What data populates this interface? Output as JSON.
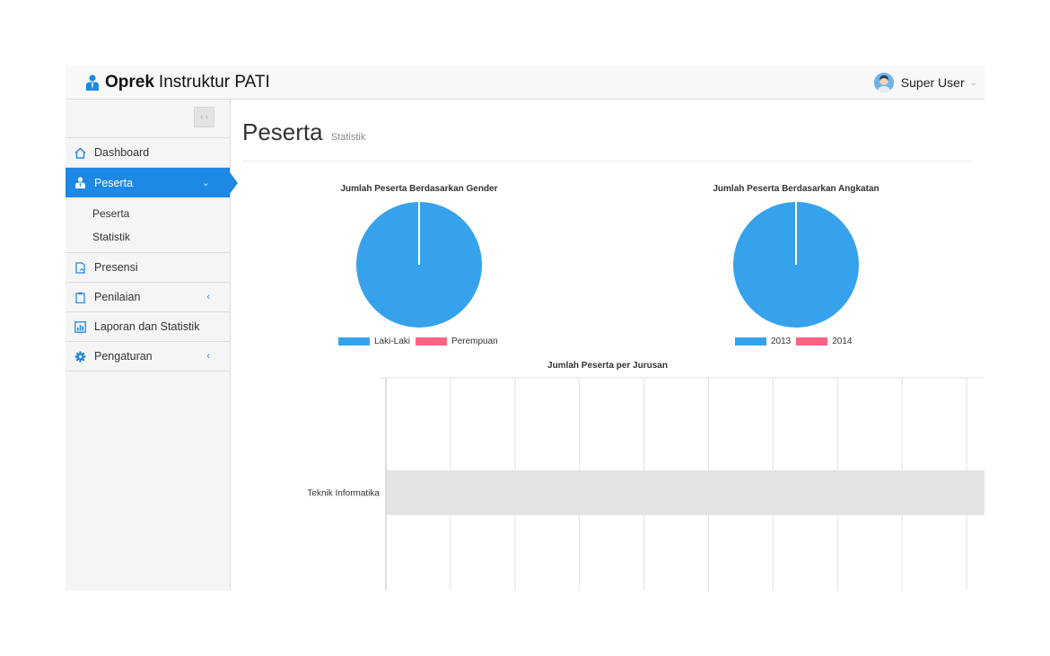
{
  "app": {
    "brand_bold": "Oprek",
    "brand_rest": "Instruktur PATI"
  },
  "user": {
    "name": "Super User"
  },
  "sidebar": {
    "toggle_glyph": "‹ ›",
    "items": [
      {
        "label": "Dashboard",
        "icon": "home-icon"
      },
      {
        "label": "Peserta",
        "icon": "user-icon",
        "active": true,
        "caret": "⌄"
      },
      {
        "label": "Presensi",
        "icon": "document-icon"
      },
      {
        "label": "Penilaian",
        "icon": "clipboard-icon",
        "caret": "‹"
      },
      {
        "label": "Laporan dan Statistik",
        "icon": "bar-chart-icon"
      },
      {
        "label": "Pengaturan",
        "icon": "gear-icon",
        "caret": "‹"
      }
    ],
    "submenu": [
      "Peserta",
      "Statistik"
    ]
  },
  "page": {
    "title": "Peserta",
    "subtitle": "Statistik"
  },
  "colors": {
    "accent": "#1e88e5",
    "series_blue": "#36a2eb",
    "series_pink": "#ff6384"
  },
  "chart_data": [
    {
      "type": "pie",
      "title": "Jumlah Peserta Berdasarkan Gender",
      "labels": [
        "Laki-Laki",
        "Perempuan"
      ],
      "values": [
        1,
        0
      ],
      "colors": [
        "#36a2eb",
        "#ff6384"
      ],
      "legend": "bottom"
    },
    {
      "type": "pie",
      "title": "Jumlah Peserta Berdasarkan Angkatan",
      "labels": [
        "2013",
        "2014"
      ],
      "values": [
        1,
        0
      ],
      "colors": [
        "#36a2eb",
        "#ff6384"
      ],
      "legend": "bottom"
    },
    {
      "type": "bar",
      "orientation": "horizontal",
      "title": "Jumlah Peserta per Jurusan",
      "categories": [
        "Teknik Informatika"
      ],
      "values": [
        0
      ],
      "grid": true
    }
  ]
}
